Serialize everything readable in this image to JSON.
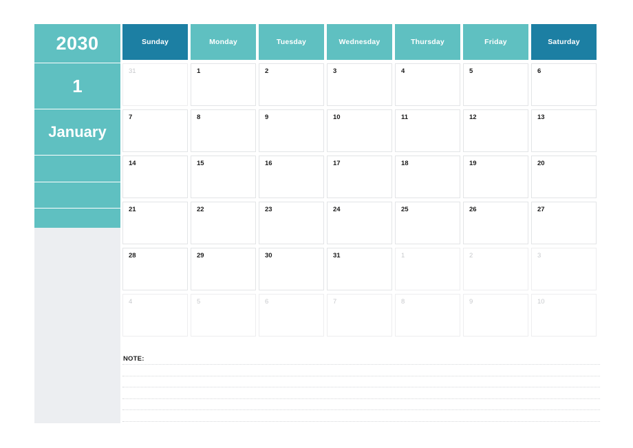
{
  "calendar": {
    "year": "2030",
    "month_number": "1",
    "month_name": "January",
    "colors": {
      "accent_teal": "#5fc0c1",
      "accent_blue": "#1c7fa3",
      "sidebar_bg": "#eceef1",
      "cell_border": "#e2e4e6",
      "muted_text": "#c7c9cc",
      "text": "#1a1a1a",
      "page_bg": "#ffffff"
    },
    "weekdays": [
      {
        "label": "Sunday",
        "weekend": true
      },
      {
        "label": "Monday",
        "weekend": false
      },
      {
        "label": "Tuesday",
        "weekend": false
      },
      {
        "label": "Wednesday",
        "weekend": false
      },
      {
        "label": "Thursday",
        "weekend": false
      },
      {
        "label": "Friday",
        "weekend": false
      },
      {
        "label": "Saturday",
        "weekend": true
      }
    ],
    "weeks": [
      [
        {
          "day": "31",
          "muted": true
        },
        {
          "day": "1",
          "muted": false
        },
        {
          "day": "2",
          "muted": false
        },
        {
          "day": "3",
          "muted": false
        },
        {
          "day": "4",
          "muted": false
        },
        {
          "day": "5",
          "muted": false
        },
        {
          "day": "6",
          "muted": false
        }
      ],
      [
        {
          "day": "7",
          "muted": false
        },
        {
          "day": "8",
          "muted": false
        },
        {
          "day": "9",
          "muted": false
        },
        {
          "day": "10",
          "muted": false
        },
        {
          "day": "11",
          "muted": false
        },
        {
          "day": "12",
          "muted": false
        },
        {
          "day": "13",
          "muted": false
        }
      ],
      [
        {
          "day": "14",
          "muted": false
        },
        {
          "day": "15",
          "muted": false
        },
        {
          "day": "16",
          "muted": false
        },
        {
          "day": "17",
          "muted": false
        },
        {
          "day": "18",
          "muted": false
        },
        {
          "day": "19",
          "muted": false
        },
        {
          "day": "20",
          "muted": false
        }
      ],
      [
        {
          "day": "21",
          "muted": false
        },
        {
          "day": "22",
          "muted": false
        },
        {
          "day": "23",
          "muted": false
        },
        {
          "day": "24",
          "muted": false
        },
        {
          "day": "25",
          "muted": false
        },
        {
          "day": "26",
          "muted": false
        },
        {
          "day": "27",
          "muted": false
        }
      ],
      [
        {
          "day": "28",
          "muted": false
        },
        {
          "day": "29",
          "muted": false
        },
        {
          "day": "30",
          "muted": false
        },
        {
          "day": "31",
          "muted": false
        },
        {
          "day": "1",
          "muted": true
        },
        {
          "day": "2",
          "muted": true
        },
        {
          "day": "3",
          "muted": true
        }
      ],
      [
        {
          "day": "4",
          "muted": true
        },
        {
          "day": "5",
          "muted": true
        },
        {
          "day": "6",
          "muted": true
        },
        {
          "day": "7",
          "muted": true
        },
        {
          "day": "8",
          "muted": true
        },
        {
          "day": "9",
          "muted": true
        },
        {
          "day": "10",
          "muted": true
        }
      ]
    ]
  },
  "note": {
    "label": "NOTE:",
    "line_count": 6
  }
}
